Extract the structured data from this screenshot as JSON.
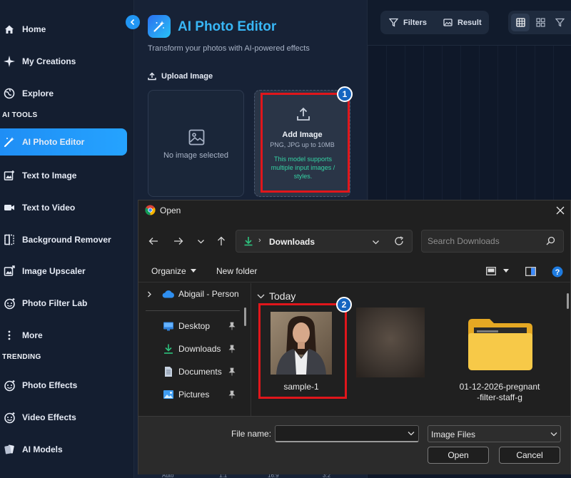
{
  "sidebar": {
    "items": [
      {
        "label": "Home",
        "icon": "home-icon"
      },
      {
        "label": "My Creations",
        "icon": "sparkle-icon"
      },
      {
        "label": "Explore",
        "icon": "globe-icon"
      }
    ],
    "sections": {
      "ai_tools": "AI TOOLS",
      "trending": "TRENDING"
    },
    "ai_tools": [
      {
        "label": "AI Photo Editor",
        "icon": "magic-wand-icon",
        "active": true
      },
      {
        "label": "Text to Image",
        "icon": "image-plus-icon"
      },
      {
        "label": "Text to Video",
        "icon": "video-icon"
      },
      {
        "label": "Background Remover",
        "icon": "split-frame-icon"
      },
      {
        "label": "Image Upscaler",
        "icon": "upscale-icon"
      },
      {
        "label": "Photo Filter Lab",
        "icon": "filter-face-icon"
      },
      {
        "label": "More",
        "icon": "more-vertical-icon"
      }
    ],
    "trending": [
      {
        "label": "Photo Effects",
        "icon": "photo-effects-icon"
      },
      {
        "label": "Video Effects",
        "icon": "video-effects-icon"
      },
      {
        "label": "AI Models",
        "icon": "cards-icon"
      }
    ],
    "active_color": "#1f8ef5"
  },
  "editor": {
    "title": "AI Photo Editor",
    "subtitle": "Transform your photos with AI-powered effects",
    "upload_heading": "Upload Image",
    "preview_empty": "No image selected",
    "add_image": {
      "label": "Add Image",
      "formats": "PNG, JPG up to 10MB",
      "note": "This model supports multiple input images / styles."
    }
  },
  "rightpanel": {
    "filters_label": "Filters",
    "result_label": "Result"
  },
  "bottom_peek": [
    "Auto",
    "1:1",
    "16:9",
    "3:2"
  ],
  "annotations": {
    "badge1": "1",
    "badge2": "2",
    "highlight_color": "#e0161b"
  },
  "dialog": {
    "title": "Open",
    "address": {
      "location": "Downloads"
    },
    "search_placeholder": "Search Downloads",
    "toolbar": {
      "organize": "Organize",
      "new_folder": "New folder"
    },
    "nav": {
      "onedrive": "Abigail - Person",
      "quick_access": [
        {
          "label": "Desktop",
          "icon": "desktop-icon"
        },
        {
          "label": "Downloads",
          "icon": "download-icon"
        },
        {
          "label": "Documents",
          "icon": "document-icon"
        },
        {
          "label": "Pictures",
          "icon": "pictures-icon"
        }
      ]
    },
    "group_label": "Today",
    "files": [
      {
        "name": "sample-1",
        "type": "image"
      },
      {
        "name": "",
        "type": "image"
      },
      {
        "name": "01-12-2026-pregnant-filter-staff-g",
        "type": "folder"
      }
    ],
    "footer": {
      "file_name_label": "File name:",
      "file_name_value": "",
      "file_type": "Image Files",
      "open": "Open",
      "cancel": "Cancel"
    }
  }
}
